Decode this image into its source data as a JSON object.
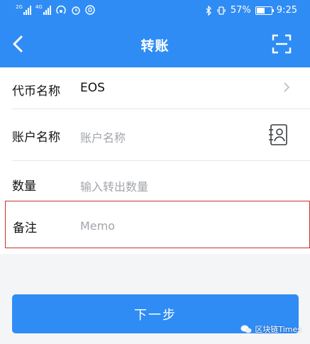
{
  "status": {
    "left_label_1": "2G",
    "left_label_2": "4G",
    "battery": "57%",
    "time": "9:25",
    "battery_level": 0.57
  },
  "header": {
    "title": "转账",
    "back_icon": "chevron-left-icon",
    "scan_icon": "scan-icon"
  },
  "form": {
    "token": {
      "label": "代币名称",
      "value": "EOS"
    },
    "account": {
      "label": "账户名称",
      "placeholder": "账户名称"
    },
    "amount": {
      "label": "数量",
      "placeholder": "输入转出数量"
    },
    "memo": {
      "label": "备注",
      "placeholder": "Memo"
    }
  },
  "next_button": "下一步",
  "watermark": "区块链Times",
  "colors": {
    "primary": "#2f8cf5",
    "highlight_border": "#c9302c"
  }
}
